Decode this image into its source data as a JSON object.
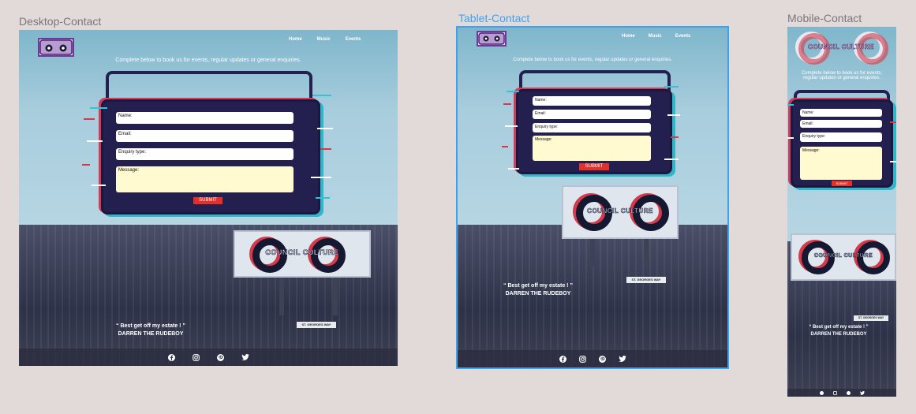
{
  "frames": {
    "desktop": {
      "label": "Desktop-Contact"
    },
    "tablet": {
      "label": "Tablet-Contact"
    },
    "mobile": {
      "label": "Mobile-Contact"
    }
  },
  "nav": {
    "home": "Home",
    "music": "Music",
    "events": "Events"
  },
  "intro": "Complete below to book us for events, regular updates or general enquiries.",
  "form": {
    "name_placeholder": "Name:",
    "email_placeholder": "Email:",
    "enquiry_placeholder": "Enquiry type:",
    "message_placeholder": "Message:",
    "submit_label": "SUBMIT"
  },
  "billboard": {
    "brand": "COUNCIL CULTURE"
  },
  "quote": {
    "text": "“ Best get off my estate ! ”",
    "author": "DARREN THE RUDEBOY"
  },
  "street_sign": "ST. GEORGES WAY",
  "social": [
    "facebook-icon",
    "instagram-icon",
    "pinterest-icon",
    "twitter-icon"
  ],
  "colors": {
    "accent": "#e3302b",
    "radio": "#23204f",
    "sky": "#9fc7da",
    "selection": "#3da3f0",
    "message_field": "#fffad0"
  }
}
